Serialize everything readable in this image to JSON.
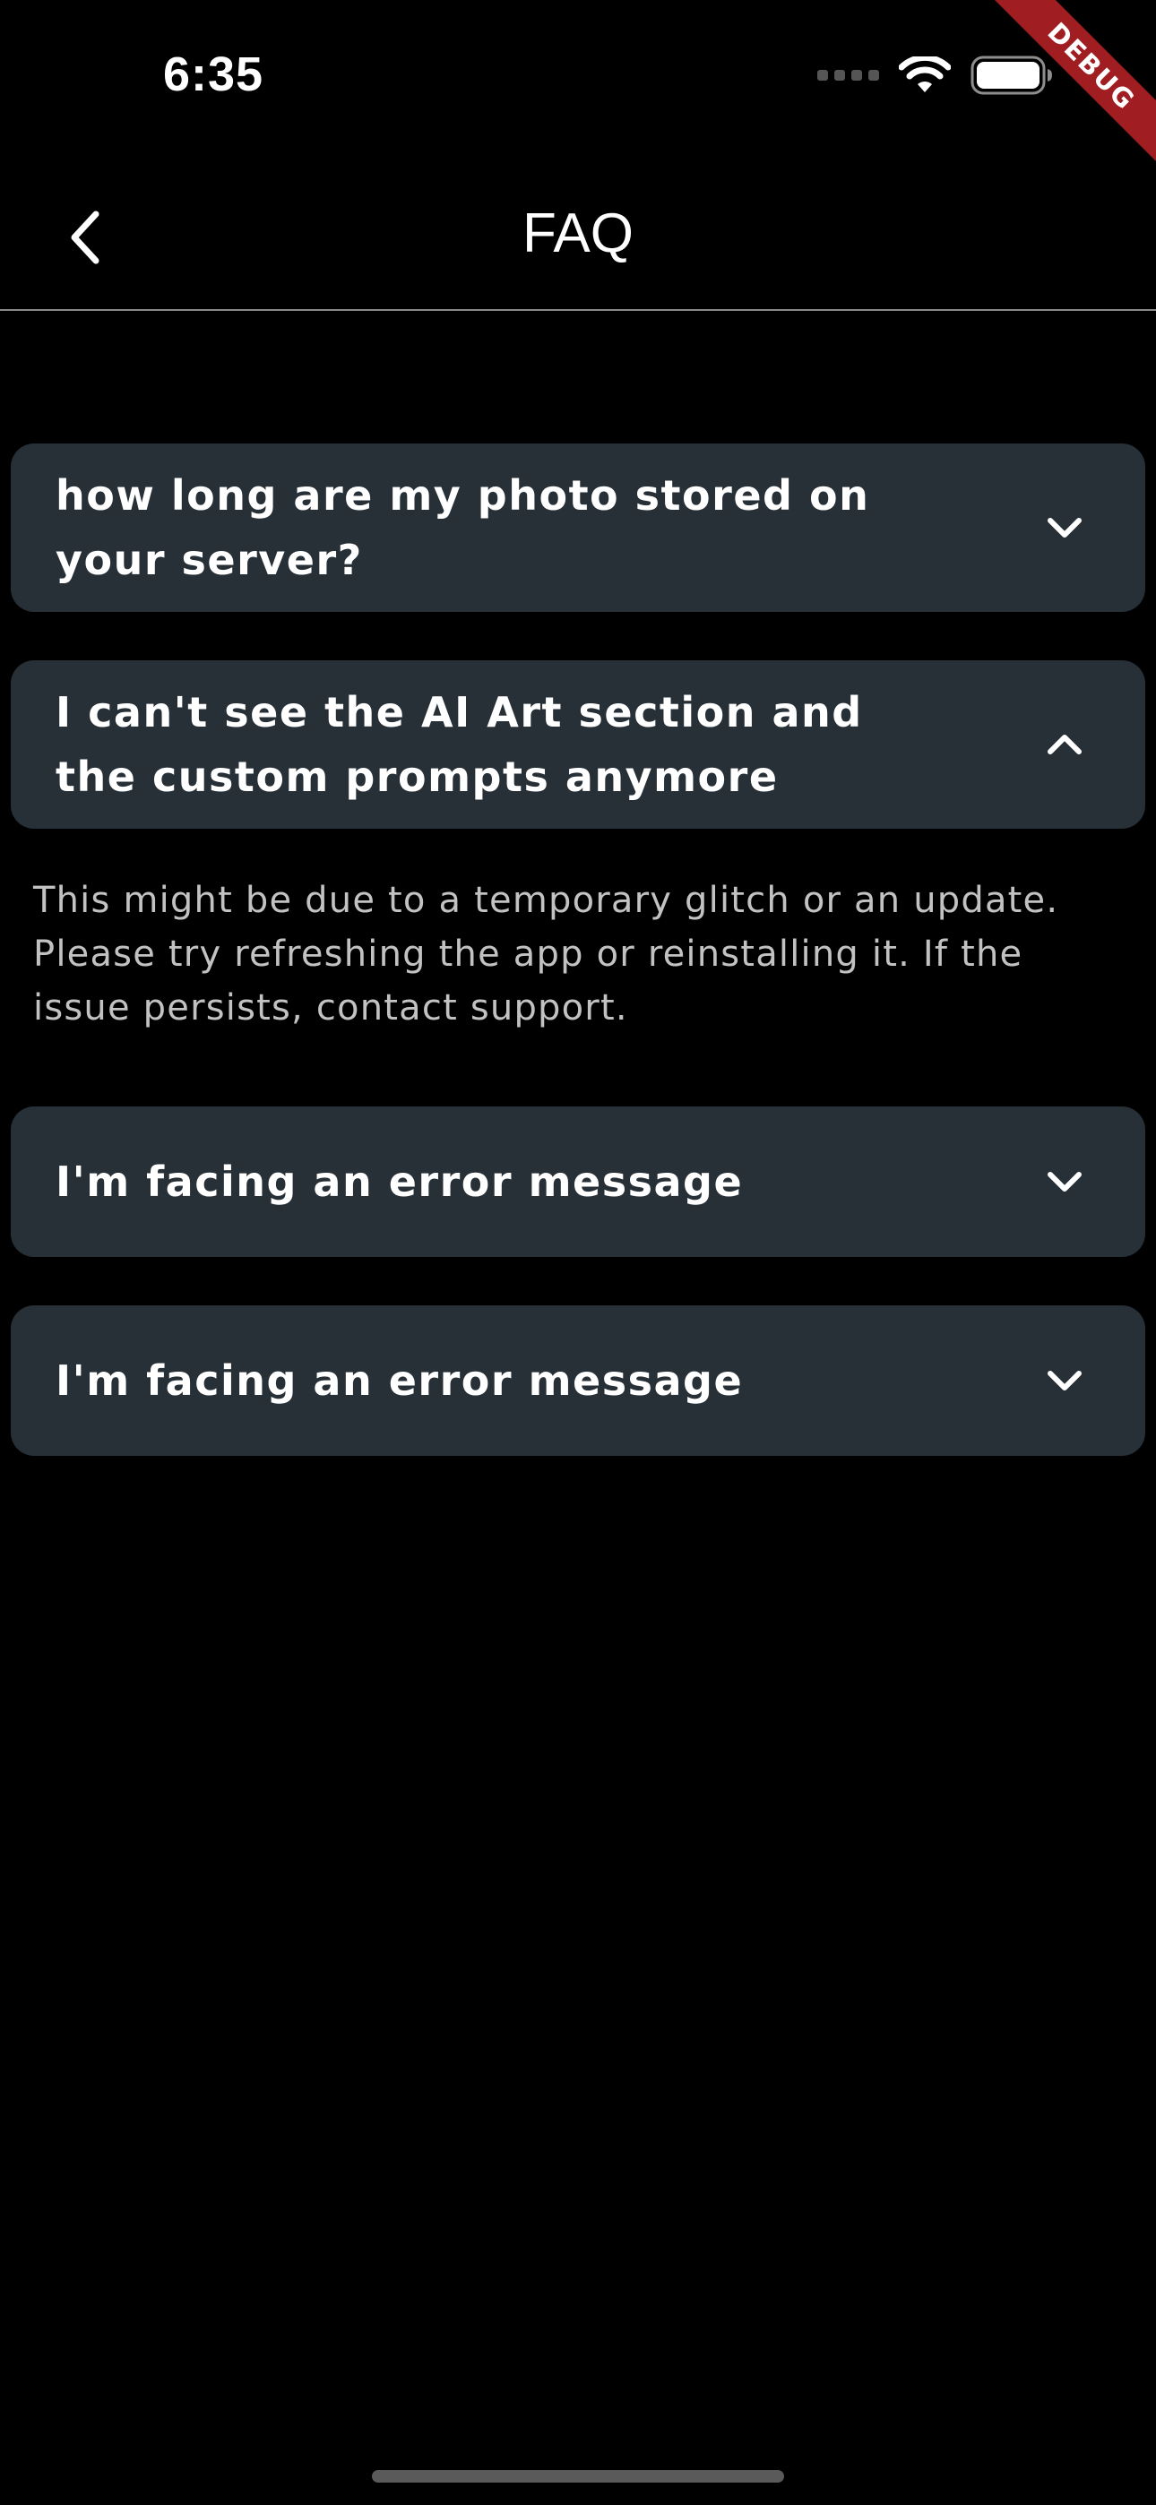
{
  "status_bar": {
    "time": "6:35"
  },
  "debug_banner": {
    "label": "DEBUG",
    "color": "#a01e22"
  },
  "app_bar": {
    "title": "FAQ",
    "back_icon": "chevron-left-icon"
  },
  "faq": {
    "items": [
      {
        "question": "how long are my photo stored on your server?",
        "expanded": false,
        "icon": "chevron-down-icon"
      },
      {
        "question": "I can't see the AI Art section and the custom prompts anymore",
        "answer": "This might be due to a temporary glitch or an update. Please try refreshing the app or reinstalling it. If the issue persists, contact support.",
        "expanded": true,
        "icon": "chevron-up-icon"
      },
      {
        "question": "I'm facing an error message",
        "expanded": false,
        "icon": "chevron-down-icon"
      },
      {
        "question": "I'm facing an error message",
        "expanded": false,
        "icon": "chevron-down-icon"
      }
    ]
  },
  "colors": {
    "background": "#000000",
    "card": "#272f37",
    "text": "#ffffff",
    "answer_text": "#c2c2c2",
    "divider": "#8a8a8a"
  }
}
